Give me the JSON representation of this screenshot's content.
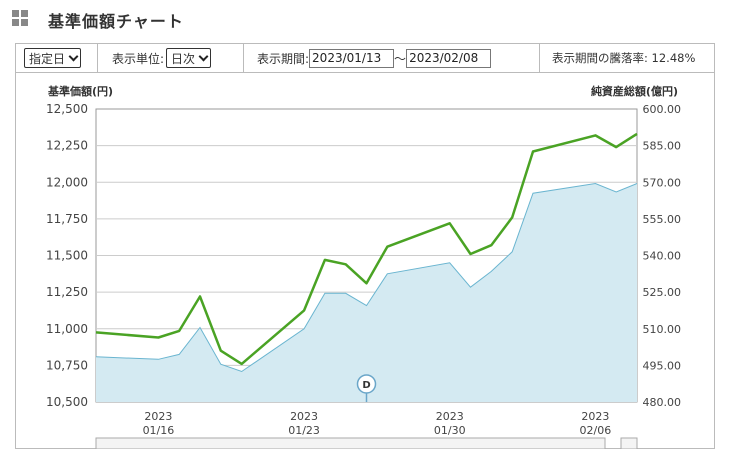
{
  "header": {
    "title": "基準価額チャート",
    "icon": "grid-icon"
  },
  "controls": {
    "period_select": "指定日",
    "unit_label": "表示単位:",
    "unit_select": "日次",
    "range_label": "表示期間:",
    "start_date": "2023/01/13",
    "separator": "～",
    "end_date": "2023/02/08",
    "change_label": "表示期間の騰落率: 12.48%"
  },
  "colors": {
    "nav_line": "#4aa324",
    "assets_fill": "#d4eaf2",
    "assets_line": "#6ab5d0",
    "grid": "#cccccc"
  },
  "chart_data": {
    "type": "line",
    "y_left_label": "基準価額(円)",
    "y_right_label": "純資産総額(億円)",
    "y_left_ticks": [
      "12,500",
      "12,250",
      "12,000",
      "11,750",
      "11,500",
      "11,250",
      "11,000",
      "10,750",
      "10,500"
    ],
    "y_right_ticks": [
      "600.00",
      "585.00",
      "570.00",
      "555.00",
      "540.00",
      "525.00",
      "510.00",
      "495.00",
      "480.00"
    ],
    "y_left_range": [
      10500,
      12500
    ],
    "y_right_range": [
      480,
      600
    ],
    "x_range": [
      "2023/01/13",
      "2023/02/08"
    ],
    "x_ticks": [
      {
        "year": "2023",
        "md": "01/16",
        "date": "2023/01/16"
      },
      {
        "year": "2023",
        "md": "01/23",
        "date": "2023/01/23"
      },
      {
        "year": "2023",
        "md": "01/30",
        "date": "2023/01/30"
      },
      {
        "year": "2023",
        "md": "02/06",
        "date": "2023/02/06"
      }
    ],
    "series": [
      {
        "name": "基準価額",
        "axis": "left",
        "x": [
          "2023/01/13",
          "2023/01/16",
          "2023/01/17",
          "2023/01/18",
          "2023/01/19",
          "2023/01/20",
          "2023/01/23",
          "2023/01/24",
          "2023/01/25",
          "2023/01/26",
          "2023/01/27",
          "2023/01/30",
          "2023/01/31",
          "2023/02/01",
          "2023/02/02",
          "2023/02/03",
          "2023/02/06",
          "2023/02/07",
          "2023/02/08"
        ],
        "values": [
          10975,
          10940,
          10985,
          11220,
          10850,
          10760,
          11125,
          11470,
          11440,
          11310,
          11560,
          11720,
          11510,
          11570,
          11760,
          12210,
          12320,
          12240,
          12330
        ]
      },
      {
        "name": "純資産総額",
        "axis": "right",
        "x": [
          "2023/01/13",
          "2023/01/16",
          "2023/01/17",
          "2023/01/18",
          "2023/01/19",
          "2023/01/20",
          "2023/01/23",
          "2023/01/24",
          "2023/01/25",
          "2023/01/26",
          "2023/01/27",
          "2023/01/30",
          "2023/01/31",
          "2023/02/01",
          "2023/02/02",
          "2023/02/03",
          "2023/02/06",
          "2023/02/07",
          "2023/02/08"
        ],
        "values": [
          498.5,
          497.5,
          499.5,
          510.5,
          495.5,
          492.5,
          510,
          524.5,
          524.5,
          519.5,
          532.5,
          537,
          527,
          533.5,
          541.5,
          565.5,
          569.5,
          566,
          569.5
        ]
      }
    ],
    "markers": [
      {
        "label": "D",
        "date": "2023/01/26"
      }
    ]
  }
}
